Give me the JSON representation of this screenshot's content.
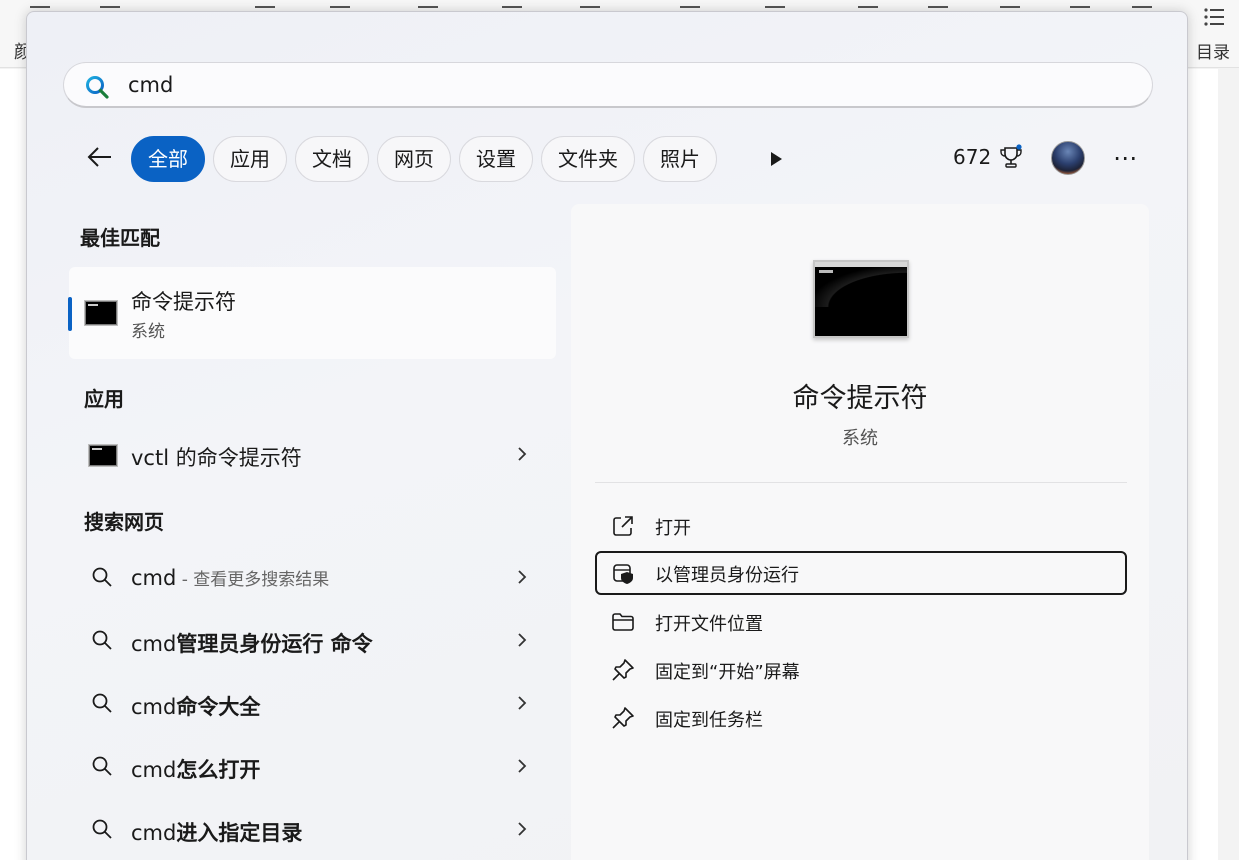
{
  "background_app": {
    "left_label": "颜",
    "right_label": "目录"
  },
  "search": {
    "query": "cmd",
    "placeholder": ""
  },
  "filters": {
    "tabs": [
      {
        "label": "全部",
        "active": true
      },
      {
        "label": "应用",
        "active": false
      },
      {
        "label": "文档",
        "active": false
      },
      {
        "label": "网页",
        "active": false
      },
      {
        "label": "设置",
        "active": false
      },
      {
        "label": "文件夹",
        "active": false
      },
      {
        "label": "照片",
        "active": false
      }
    ]
  },
  "rewards": {
    "points": "672"
  },
  "colors": {
    "accent": "#0a62c4",
    "focus_border": "#1a1a1a"
  },
  "best_match": {
    "section_title": "最佳匹配",
    "item": {
      "title": "命令提示符",
      "subtitle": "系统",
      "icon": "cmd-console-icon"
    }
  },
  "apps": {
    "section_title": "应用",
    "items": [
      {
        "label": "vctl 的命令提示符",
        "icon": "cmd-console-icon"
      }
    ]
  },
  "web": {
    "section_title": "搜索网页",
    "items": [
      {
        "prefix": "cmd",
        "bold": "",
        "suffix": " - 查看更多搜索结果"
      },
      {
        "prefix": "cmd",
        "bold": "管理员身份运行 命令",
        "suffix": ""
      },
      {
        "prefix": "cmd",
        "bold": "命令大全",
        "suffix": ""
      },
      {
        "prefix": "cmd",
        "bold": "怎么打开",
        "suffix": ""
      },
      {
        "prefix": "cmd",
        "bold": "进入指定目录",
        "suffix": ""
      }
    ]
  },
  "preview": {
    "title": "命令提示符",
    "subtitle": "系统",
    "actions": [
      {
        "label": "打开",
        "icon": "open-external-icon",
        "focused": false
      },
      {
        "label": "以管理员身份运行",
        "icon": "shield-admin-icon",
        "focused": true
      },
      {
        "label": "打开文件位置",
        "icon": "folder-icon",
        "focused": false
      },
      {
        "label": "固定到“开始”屏幕",
        "icon": "pin-icon",
        "focused": false
      },
      {
        "label": "固定到任务栏",
        "icon": "pin-icon",
        "focused": false
      }
    ]
  }
}
